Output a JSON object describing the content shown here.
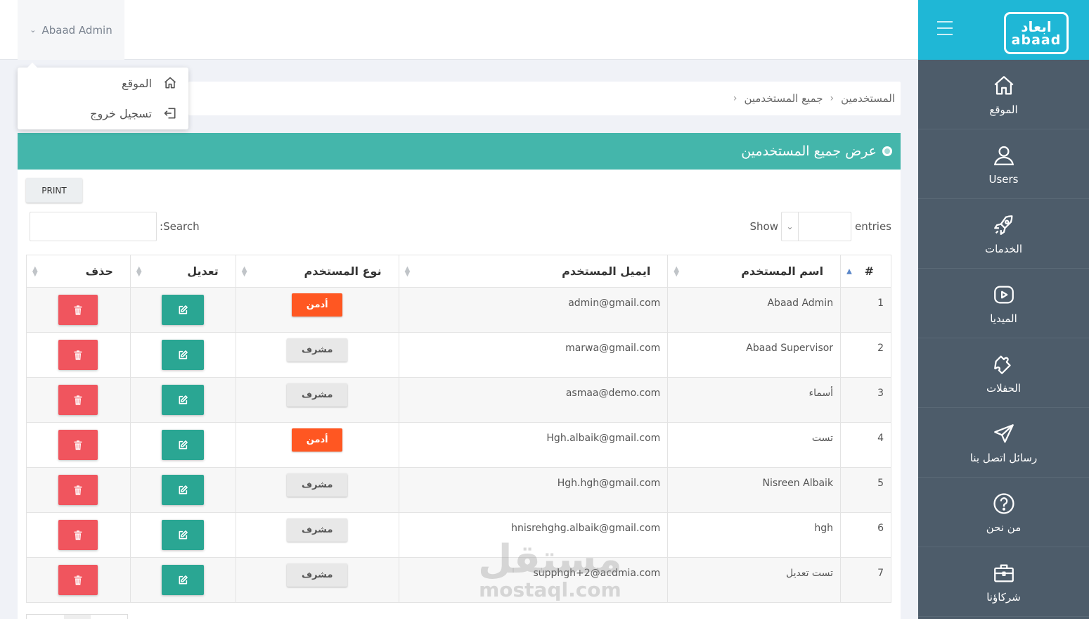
{
  "topbar": {
    "user_name": "Abaad Admin",
    "dropdown": [
      {
        "label": "الموقع",
        "icon": "home-icon"
      },
      {
        "label": "تسجيل خروج",
        "icon": "logout-icon"
      }
    ]
  },
  "sidebar": {
    "logo_ar": "ابعاد",
    "logo_en": "abaad",
    "items": [
      {
        "label": "الموقع",
        "icon": "home-icon"
      },
      {
        "label": "Users",
        "icon": "user-icon"
      },
      {
        "label": "الخدمات",
        "icon": "rocket-icon"
      },
      {
        "label": "الميديا",
        "icon": "play-icon"
      },
      {
        "label": "الحفلات",
        "icon": "puzzle-icon"
      },
      {
        "label": "رسائل اتصل بنا",
        "icon": "send-icon"
      },
      {
        "label": "من نحن",
        "icon": "help-icon"
      },
      {
        "label": "شركاؤنا",
        "icon": "briefcase-icon"
      }
    ]
  },
  "breadcrumb": {
    "items": [
      "المستخدمين",
      "جميع المستخدمين"
    ]
  },
  "panel": {
    "title": "عرض جميع المستخدمين",
    "print_label": "PRINT",
    "search_label": "Search:",
    "show_label": "Show",
    "entries_label": "entries"
  },
  "table": {
    "headers": [
      "#",
      "اسم المستخدم",
      "ايميل المستخدم",
      "نوع المستخدم",
      "تعديل",
      "حذف"
    ],
    "rows": [
      {
        "num": "1",
        "name": "Abaad Admin",
        "email": "admin@gmail.com",
        "type": "أدمن",
        "type_kind": "admin"
      },
      {
        "num": "2",
        "name": "Abaad Supervisor",
        "email": "marwa@gmail.com",
        "type": "مشرف",
        "type_kind": "sup"
      },
      {
        "num": "3",
        "name": "أسماء",
        "email": "asmaa@demo.com",
        "type": "مشرف",
        "type_kind": "sup"
      },
      {
        "num": "4",
        "name": "تست",
        "email": "Hgh.albaik@gmail.com",
        "type": "أدمن",
        "type_kind": "admin"
      },
      {
        "num": "5",
        "name": "Nisreen Albaik",
        "email": "Hgh.hgh@gmail.com",
        "type": "مشرف",
        "type_kind": "sup"
      },
      {
        "num": "6",
        "name": "hgh",
        "email": "hnisrehghg.albaik@gmail.com",
        "type": "مشرف",
        "type_kind": "sup"
      },
      {
        "num": "7",
        "name": "تست تعديل",
        "email": "supphgh+2@acdmia.com",
        "type": "مشرف",
        "type_kind": "sup"
      }
    ]
  },
  "watermark": {
    "ar": "مستقل",
    "en": "mostaql.com"
  },
  "colors": {
    "sidebar": "#4d5c6a",
    "header": "#1fb7d6",
    "panel_head": "#44b6ab",
    "admin": "#ff5722",
    "edit": "#2aa693",
    "delete": "#f0555e"
  }
}
